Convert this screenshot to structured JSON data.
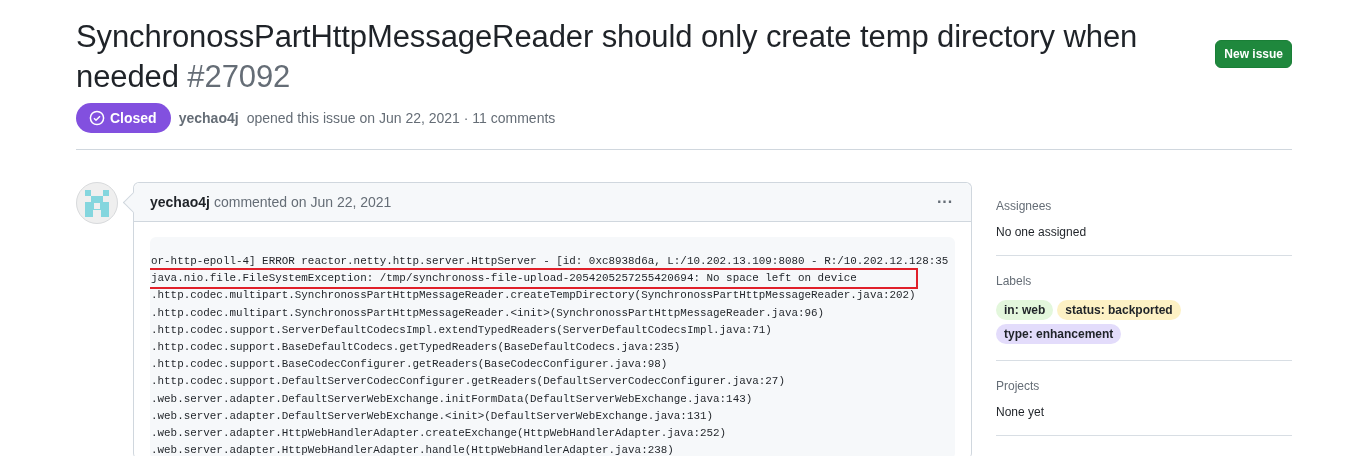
{
  "issue": {
    "title": "SynchronossPartHttpMessageReader should only create temp directory when needed",
    "number": "#27092",
    "state": "Closed",
    "author": "yechao4j",
    "meta": "opened this issue on Jun 22, 2021 · 11 comments"
  },
  "new_issue_button": "New issue",
  "comment": {
    "author": "yechao4j",
    "meta": "commented on Jun 22, 2021",
    "menu": "···",
    "code_lines": [
      {
        "text": "or-http-epoll-4] ERROR reactor.netty.http.server.HttpServer - [id: 0xc8938d6a, L:/10.202.13.109:8080 - R:/10.202.12.128:35",
        "highlighted": false
      },
      {
        "text": "java.nio.file.FileSystemException: /tmp/synchronoss-file-upload-2054205257255420694: No space left on device",
        "highlighted": true
      },
      {
        "text": ".http.codec.multipart.SynchronossPartHttpMessageReader.createTempDirectory(SynchronossPartHttpMessageReader.java:202)",
        "highlighted": false
      },
      {
        "text": ".http.codec.multipart.SynchronossPartHttpMessageReader.<init>(SynchronossPartHttpMessageReader.java:96)",
        "highlighted": false
      },
      {
        "text": ".http.codec.support.ServerDefaultCodecsImpl.extendTypedReaders(ServerDefaultCodecsImpl.java:71)",
        "highlighted": false
      },
      {
        "text": ".http.codec.support.BaseDefaultCodecs.getTypedReaders(BaseDefaultCodecs.java:235)",
        "highlighted": false
      },
      {
        "text": ".http.codec.support.BaseCodecConfigurer.getReaders(BaseCodecConfigurer.java:98)",
        "highlighted": false
      },
      {
        "text": ".http.codec.support.DefaultServerCodecConfigurer.getReaders(DefaultServerCodecConfigurer.java:27)",
        "highlighted": false
      },
      {
        "text": ".web.server.adapter.DefaultServerWebExchange.initFormData(DefaultServerWebExchange.java:143)",
        "highlighted": false
      },
      {
        "text": ".web.server.adapter.DefaultServerWebExchange.<init>(DefaultServerWebExchange.java:131)",
        "highlighted": false
      },
      {
        "text": ".web.server.adapter.HttpWebHandlerAdapter.createExchange(HttpWebHandlerAdapter.java:252)",
        "highlighted": false
      },
      {
        "text": ".web.server.adapter.HttpWebHandlerAdapter.handle(HttpWebHandlerAdapter.java:238)",
        "highlighted": false
      }
    ]
  },
  "sidebar": [
    {
      "heading": "Assignees",
      "value": "No one assigned"
    },
    {
      "heading": "Labels",
      "labels": [
        {
          "text": "in: web",
          "color": "#e3f7dc"
        },
        {
          "text": "status: backported",
          "color": "#fdf1c4"
        },
        {
          "text": "type: enhancement",
          "color": "#e3dcfb"
        }
      ]
    },
    {
      "heading": "Projects",
      "value": "None yet"
    }
  ]
}
